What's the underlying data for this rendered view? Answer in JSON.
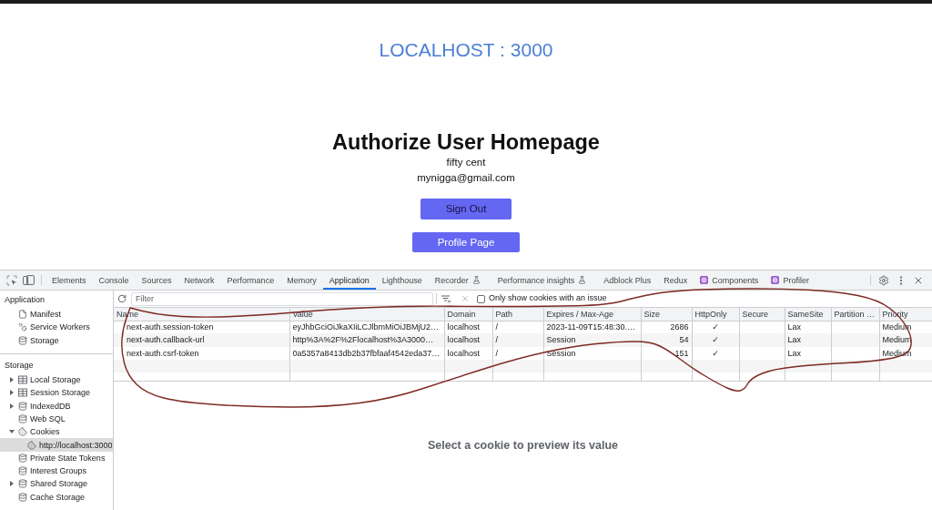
{
  "page": {
    "host_label": "LOCALHOST : 3000",
    "title": "Authorize User Homepage",
    "user_name": "fifty cent",
    "user_email": "mynigga@gmail.com",
    "buttons": [
      {
        "label": "Sign Out",
        "kind": "primary"
      },
      {
        "label": "Profile Page",
        "kind": "secondary"
      }
    ]
  },
  "devtools": {
    "tabs": [
      {
        "label": "Elements",
        "kind": "plain",
        "selected": false
      },
      {
        "label": "Console",
        "kind": "plain",
        "selected": false
      },
      {
        "label": "Sources",
        "kind": "plain",
        "selected": false
      },
      {
        "label": "Network",
        "kind": "plain",
        "selected": false
      },
      {
        "label": "Performance",
        "kind": "plain",
        "selected": false
      },
      {
        "label": "Memory",
        "kind": "plain",
        "selected": false
      },
      {
        "label": "Application",
        "kind": "plain",
        "selected": true
      },
      {
        "label": "Lighthouse",
        "kind": "plain",
        "selected": false
      },
      {
        "label": "Recorder",
        "kind": "experimental",
        "selected": false
      },
      {
        "label": "Performance insights",
        "kind": "experimental",
        "selected": false
      },
      {
        "label": "Adblock Plus",
        "kind": "plain",
        "selected": false
      },
      {
        "label": "Redux",
        "kind": "plain",
        "selected": false
      },
      {
        "label": "Components",
        "kind": "extension",
        "selected": false
      },
      {
        "label": "Profiler",
        "kind": "extension",
        "selected": false
      }
    ],
    "sidebar": {
      "sections": [
        {
          "title": "Application",
          "items": [
            {
              "label": "Manifest",
              "kind": "document",
              "selected": false
            },
            {
              "label": "Service Workers",
              "kind": "workers",
              "selected": false
            },
            {
              "label": "Storage",
              "kind": "database",
              "selected": false
            }
          ]
        },
        {
          "title": "Storage",
          "items": [
            {
              "label": "Local Storage",
              "kind": "table",
              "expanded": false,
              "selected": false
            },
            {
              "label": "Session Storage",
              "kind": "table",
              "expanded": false,
              "selected": false
            },
            {
              "label": "IndexedDB",
              "kind": "database",
              "expanded": false,
              "selected": false
            },
            {
              "label": "Web SQL",
              "kind": "database",
              "selected": false
            },
            {
              "label": "Cookies",
              "kind": "cookie",
              "expanded": true,
              "selected": false,
              "children": [
                {
                  "label": "http://localhost:3000",
                  "kind": "cookie",
                  "selected": true
                }
              ]
            },
            {
              "label": "Private State Tokens",
              "kind": "database",
              "selected": false
            },
            {
              "label": "Interest Groups",
              "kind": "database",
              "selected": false
            },
            {
              "label": "Shared Storage",
              "kind": "database",
              "expanded": false,
              "selected": false
            },
            {
              "label": "Cache Storage",
              "kind": "database",
              "selected": false
            }
          ]
        }
      ]
    },
    "toolbar": {
      "filter": {
        "placeholder": "Filter"
      },
      "issue_filter": {
        "label": "Only show cookies with an issue",
        "checked": false
      }
    },
    "table": {
      "columns": [
        "Name",
        "Value",
        "Domain",
        "Path",
        "Expires / Max-Age",
        "Size",
        "HttpOnly",
        "Secure",
        "SameSite",
        "Partition …",
        "Priority"
      ],
      "rows": [
        {
          "selected": false,
          "name": "next-auth.session-token",
          "value": "eyJhbGciOiJkaXIiLCJlbmMiOiJBMjU2…",
          "domain": "localhost",
          "path": "/",
          "expires": "2023-11-09T15:48:30.…",
          "size": "2686",
          "http_only": "✓",
          "same_site": "Lax",
          "priority": "Medium"
        },
        {
          "selected": false,
          "name": "next-auth.callback-url",
          "value": "http%3A%2F%2Flocalhost%3A3000…",
          "domain": "localhost",
          "path": "/",
          "expires": "Session",
          "size": "54",
          "http_only": "✓",
          "same_site": "Lax",
          "priority": "Medium"
        },
        {
          "selected": false,
          "name": "next-auth.csrf-token",
          "value": "0a5357a8413db2b37fbfaaf4542eda37…",
          "domain": "localhost",
          "path": "/",
          "expires": "Session",
          "size": "151",
          "http_only": "✓",
          "same_site": "Lax",
          "priority": "Medium"
        }
      ]
    },
    "preview_message": "Select a cookie to preview its value"
  }
}
